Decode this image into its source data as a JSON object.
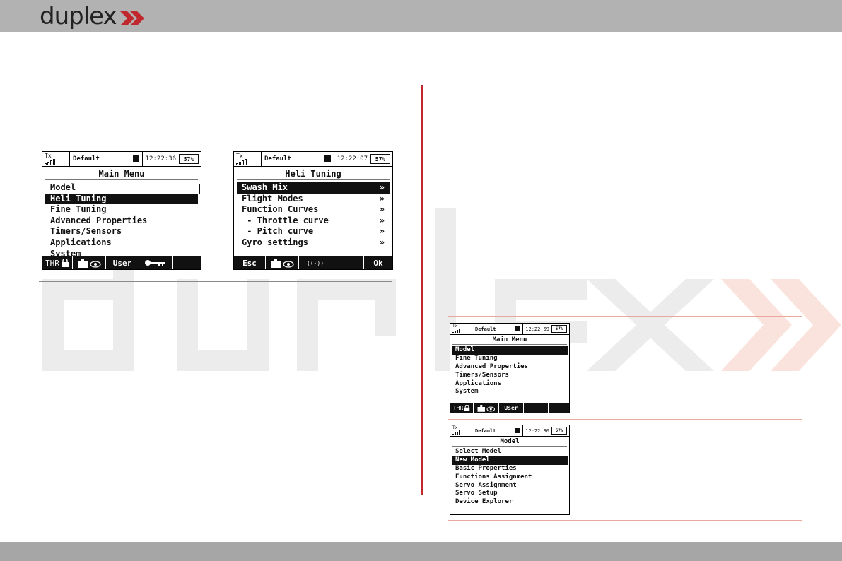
{
  "header": {
    "logo_text": "duplex"
  },
  "screens": {
    "main_menu_big": {
      "status": {
        "tx": "Tx",
        "profile": "Default",
        "clock": "12:22:36",
        "battery": "57%"
      },
      "title": "Main Menu",
      "items": [
        "Model",
        "Heli Tuning",
        "Fine Tuning",
        "Advanced Properties",
        "Timers/Sensors",
        "Applications",
        "System"
      ],
      "footer": [
        "THR",
        "",
        "User",
        "",
        ""
      ]
    },
    "heli_tuning": {
      "status": {
        "tx": "Tx",
        "profile": "Default",
        "clock": "12:22:07",
        "battery": "57%"
      },
      "title": "Heli Tuning",
      "items": [
        "Swash Mix",
        "Flight Modes",
        "Function Curves",
        " - Throttle curve",
        " - Pitch curve",
        "Gyro settings"
      ],
      "arrow": "»",
      "footer": [
        "Esc",
        "",
        "((·))",
        "",
        "Ok"
      ]
    },
    "main_menu_small": {
      "status": {
        "tx": "Tx",
        "profile": "Default",
        "clock": "12:22:59",
        "battery": "57%"
      },
      "title": "Main Menu",
      "items": [
        "Model",
        "Fine Tuning",
        "Advanced Properties",
        "Timers/Sensors",
        "Applications",
        "System"
      ],
      "footer": [
        "THR",
        "",
        "User",
        "",
        ""
      ]
    },
    "model_menu": {
      "status": {
        "tx": "Tx",
        "profile": "Default",
        "clock": "12:22:30",
        "battery": "57%"
      },
      "title": "Model",
      "items": [
        "Select Model",
        "New Model",
        "Basic Properties",
        "Functions Assignment",
        "Servo Assignment",
        "Servo Setup",
        "Device Explorer"
      ]
    }
  },
  "colors": {
    "topbar": "#b2b2b2",
    "bottombar": "#a6a6a6",
    "accent_red": "#c0282d"
  }
}
